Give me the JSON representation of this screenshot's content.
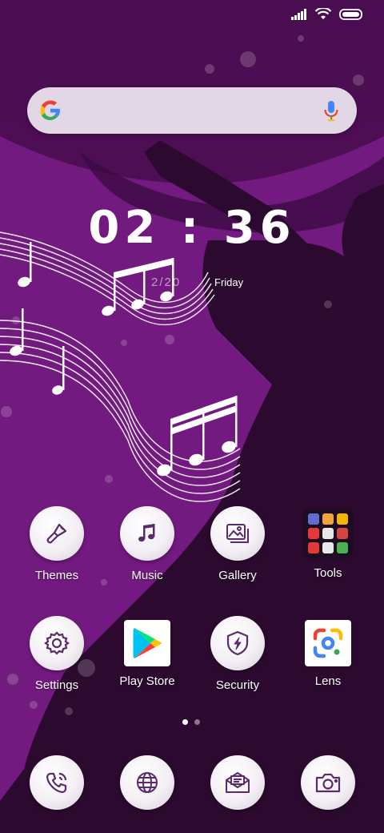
{
  "status_bar": {
    "signal_icon": "signal-icon",
    "wifi_icon": "wifi-icon",
    "battery_icon": "battery-icon"
  },
  "search_bar": {
    "logo_icon": "google-logo-icon",
    "mic_icon": "mic-icon"
  },
  "clock": {
    "time": "02 : 36",
    "date": "2/20",
    "day": "Friday"
  },
  "apps_row1": [
    {
      "label": "Themes",
      "icon": "paintbrush-icon"
    },
    {
      "label": "Music",
      "icon": "music-note-icon"
    },
    {
      "label": "Gallery",
      "icon": "gallery-icon"
    },
    {
      "label": "Tools",
      "icon": "tools-folder-icon"
    }
  ],
  "apps_row2": [
    {
      "label": "Settings",
      "icon": "gear-icon"
    },
    {
      "label": "Play Store",
      "icon": "play-store-icon"
    },
    {
      "label": "Security",
      "icon": "shield-icon"
    },
    {
      "label": "Lens",
      "icon": "lens-icon"
    }
  ],
  "page_indicator": {
    "current": 1,
    "total": 2
  },
  "dock": [
    {
      "icon": "phone-icon"
    },
    {
      "icon": "globe-icon"
    },
    {
      "icon": "messages-icon"
    },
    {
      "icon": "camera-icon"
    }
  ],
  "colors": {
    "background": "#3a0a3e",
    "accent": "#7a1a86",
    "silhouette": "#2c0a30"
  }
}
